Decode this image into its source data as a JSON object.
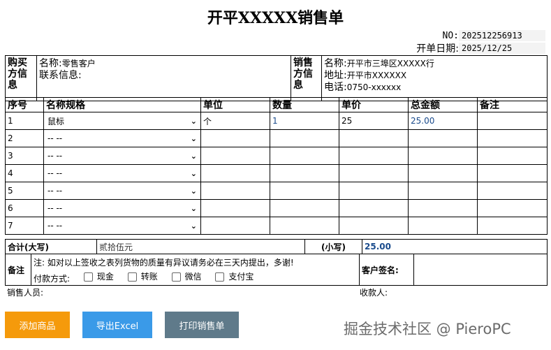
{
  "title": "开平XXXXX销售单",
  "meta": {
    "no_label": "NO:",
    "no_value": "202512256913",
    "date_label": "开单日期:",
    "date_value": "2025/12/25"
  },
  "buyer": {
    "heading": "购买方信息",
    "name_label": "名称:",
    "name_value": "零售客户",
    "contact_label": "联系信息:",
    "contact_value": ""
  },
  "seller": {
    "heading": "销售方信息",
    "name_label": "名称:",
    "name_value": "开平市三埠区XXXXX行",
    "address_label": "地址:",
    "address_value": "开平市XXXXXX",
    "phone_label": "电话:",
    "phone_value": "0750-xxxxxx"
  },
  "items": {
    "headers": [
      "序号",
      "名称规格",
      "单位",
      "数量",
      "单价",
      "总金额",
      "备注"
    ],
    "rows": [
      {
        "no": "1",
        "product": "鼠标",
        "unit": "个",
        "qty": "1",
        "price": "25",
        "amount": "25.00",
        "remark": ""
      },
      {
        "no": "2",
        "product": "-- --",
        "unit": "",
        "qty": "",
        "price": "",
        "amount": "",
        "remark": ""
      },
      {
        "no": "3",
        "product": "-- --",
        "unit": "",
        "qty": "",
        "price": "",
        "amount": "",
        "remark": ""
      },
      {
        "no": "4",
        "product": "-- --",
        "unit": "",
        "qty": "",
        "price": "",
        "amount": "",
        "remark": ""
      },
      {
        "no": "5",
        "product": "-- --",
        "unit": "",
        "qty": "",
        "price": "",
        "amount": "",
        "remark": ""
      },
      {
        "no": "6",
        "product": "-- --",
        "unit": "",
        "qty": "",
        "price": "",
        "amount": "",
        "remark": ""
      },
      {
        "no": "7",
        "product": "-- --",
        "unit": "",
        "qty": "",
        "price": "",
        "amount": "",
        "remark": ""
      }
    ]
  },
  "total": {
    "upper_label": "合计(大写)",
    "upper_value": "贰拾伍元",
    "lower_label": "(小写)",
    "lower_value": "25.00"
  },
  "note": {
    "label": "备注",
    "text": "注: 如对以上签收之表列货物的质量有异议请务必在三天内提出，多谢!",
    "payment_label": "付款方式:",
    "payment_options": [
      "现金",
      "转账",
      "微信",
      "支付宝"
    ],
    "customer_sign_label": "客户签名:"
  },
  "footer": {
    "salesperson_label": "销售人员:",
    "cashier_label": "收款人:"
  },
  "buttons": {
    "add": "添加商品",
    "export": "导出Excel",
    "print": "打印销售单"
  },
  "watermark": "掘金技术社区 @ PieroPC",
  "colors": {
    "add_button": "#f59a0b",
    "export_button": "#3a9ae8",
    "print_button": "#5f7a8a",
    "amount_text": "#1a4b8c"
  }
}
